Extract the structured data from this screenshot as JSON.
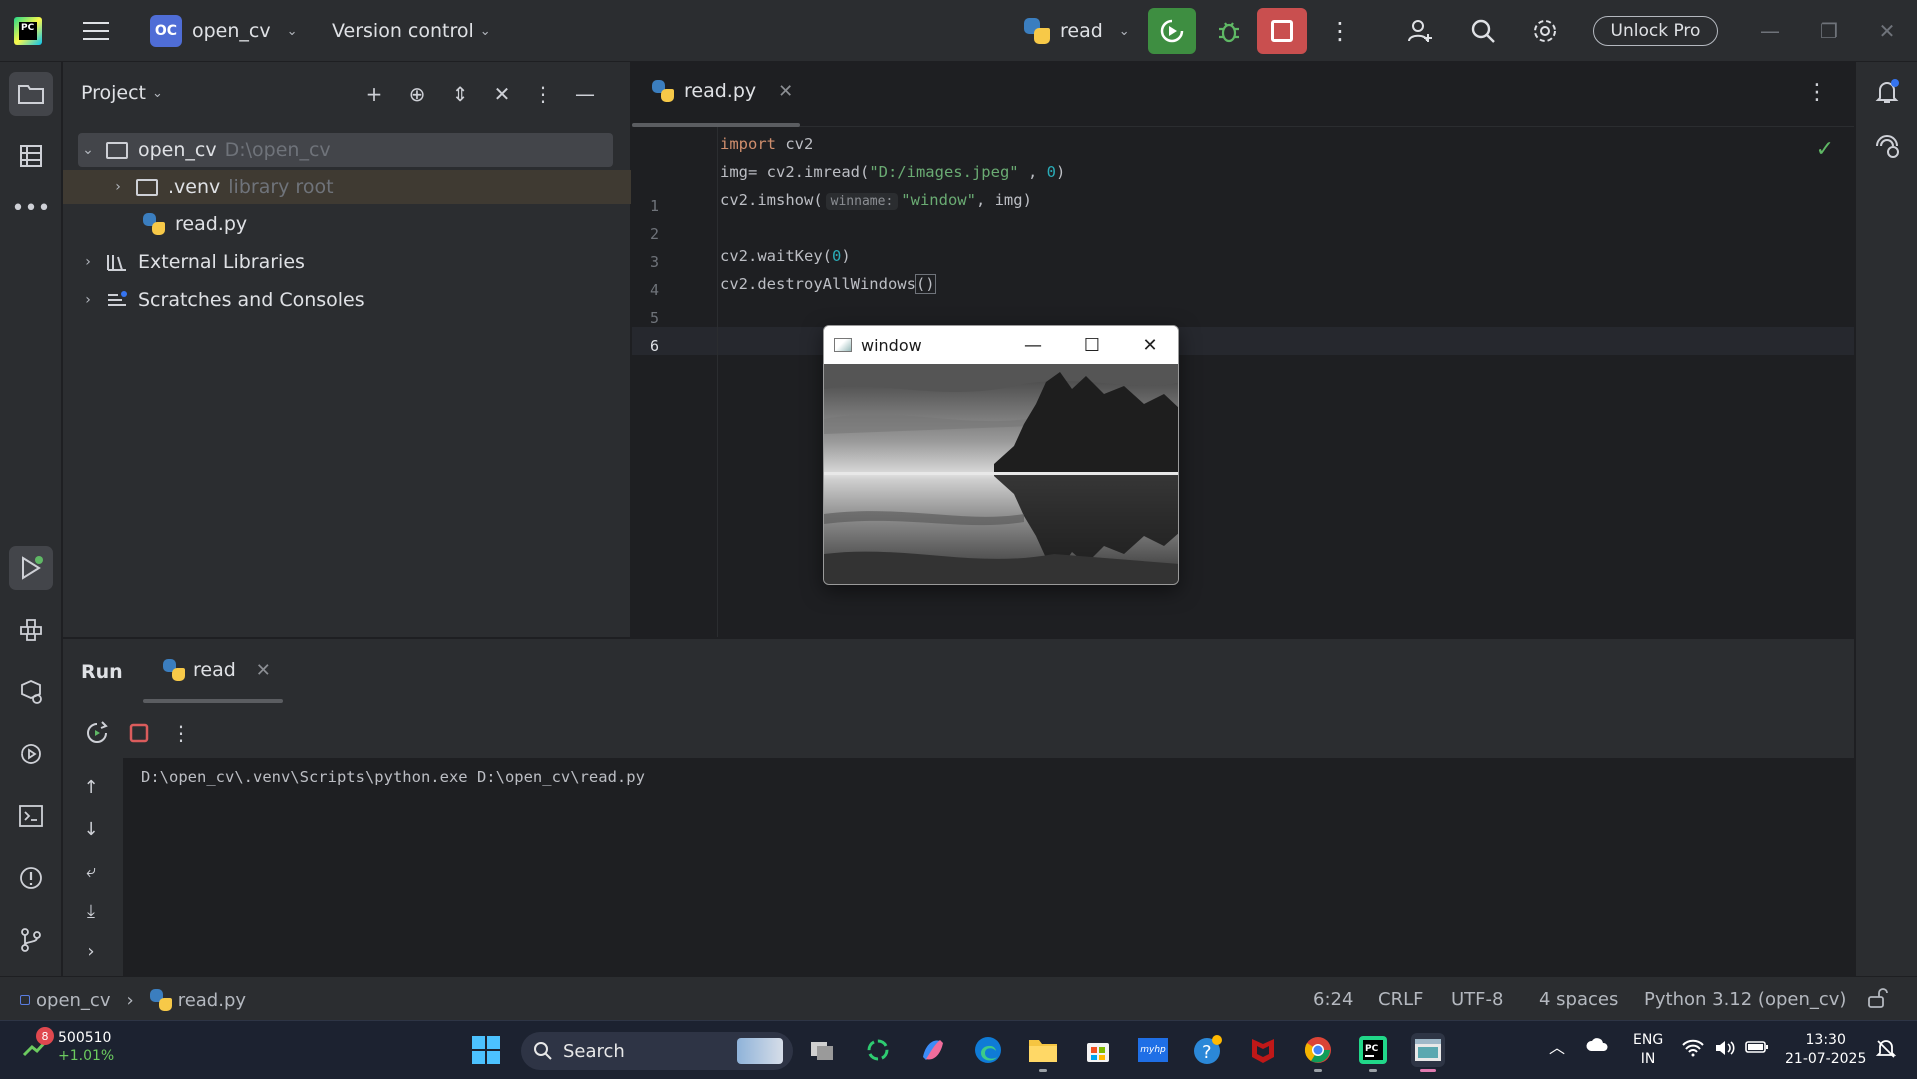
{
  "titlebar": {
    "logo_text": "PC",
    "project_badge": "OC",
    "project_name": "open_cv",
    "version_control": "Version control",
    "run_config": "read",
    "unlock": "Unlock Pro"
  },
  "project_panel": {
    "title": "Project",
    "tree": [
      {
        "label": "open_cv",
        "hint": "D:\\open_cv"
      },
      {
        "label": ".venv",
        "hint": "library root"
      },
      {
        "label": "read.py",
        "hint": ""
      },
      {
        "label": "External Libraries",
        "hint": ""
      },
      {
        "label": "Scratches and Consoles",
        "hint": ""
      }
    ]
  },
  "editor": {
    "tab": "read.py",
    "line_numbers": [
      "1",
      "2",
      "3",
      "4",
      "5",
      "6"
    ],
    "code": {
      "l1_kw": "import",
      "l1_rest": " cv2",
      "l2_a": "img= cv2.imread(",
      "l2_str": "\"D:/images.jpeg\"",
      "l2_b": " , ",
      "l2_num": "0",
      "l2_c": ")",
      "l3_a": "cv2.imshow(",
      "l3_hint": "winname:",
      "l3_str": "\"window\"",
      "l3_b": ", img)",
      "l5_a": "cv2.waitKey(",
      "l5_num": "0",
      "l5_b": ")",
      "l6_a": "cv2.destroyAllWindows",
      "l6_b": "()"
    }
  },
  "cv_window": {
    "title": "window"
  },
  "run_panel": {
    "title": "Run",
    "tab": "read",
    "console": "D:\\open_cv\\.venv\\Scripts\\python.exe D:\\open_cv\\read.py"
  },
  "statusbar": {
    "crumb_project": "open_cv",
    "crumb_file": "read.py",
    "position": "6:24",
    "line_sep": "CRLF",
    "encoding": "UTF-8",
    "indent": "4 spaces",
    "interpreter": "Python 3.12 (open_cv)"
  },
  "taskbar": {
    "stock_badge": "8",
    "stock_value": "500510",
    "stock_change": "+1.01%",
    "search": "Search",
    "lang_1": "ENG",
    "lang_2": "IN",
    "time": "13:30",
    "date": "21-07-2025"
  },
  "colors": {
    "accent_green": "#3e8e41",
    "stop_red": "#c94f4f",
    "keyword": "#cf8e6d",
    "string": "#6aab73",
    "number": "#2aacb8"
  }
}
